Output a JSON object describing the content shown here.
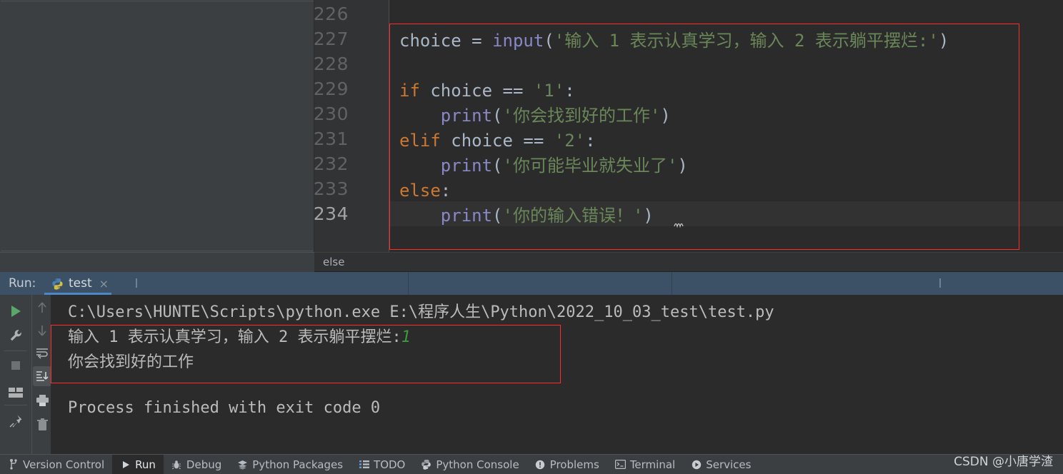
{
  "editor": {
    "breadcrumb": "else",
    "line_numbers": [
      "226",
      "227",
      "228",
      "229",
      "230",
      "231",
      "232",
      "233",
      "234"
    ],
    "current_line": "234",
    "lines": [
      {
        "num": "226",
        "segments": []
      },
      {
        "num": "227",
        "segments": [
          {
            "t": "choice ",
            "c": "id"
          },
          {
            "t": "= ",
            "c": "punc"
          },
          {
            "t": "input",
            "c": "fn"
          },
          {
            "t": "(",
            "c": "punc"
          },
          {
            "t": "'输入 1 表示认真学习，输入 2 表示躺平摆烂:'",
            "c": "str"
          },
          {
            "t": ")",
            "c": "punc"
          }
        ]
      },
      {
        "num": "228",
        "segments": []
      },
      {
        "num": "229",
        "segments": [
          {
            "t": "if",
            "c": "kw"
          },
          {
            "t": " choice ",
            "c": "id"
          },
          {
            "t": "== ",
            "c": "punc"
          },
          {
            "t": "'1'",
            "c": "str"
          },
          {
            "t": ":",
            "c": "punc"
          }
        ]
      },
      {
        "num": "230",
        "segments": [
          {
            "t": "    ",
            "c": "punc"
          },
          {
            "t": "print",
            "c": "fn"
          },
          {
            "t": "(",
            "c": "punc"
          },
          {
            "t": "'你会找到好的工作'",
            "c": "str"
          },
          {
            "t": ")",
            "c": "punc"
          }
        ]
      },
      {
        "num": "231",
        "segments": [
          {
            "t": "elif",
            "c": "kw"
          },
          {
            "t": " choice ",
            "c": "id"
          },
          {
            "t": "== ",
            "c": "punc"
          },
          {
            "t": "'2'",
            "c": "str"
          },
          {
            "t": ":",
            "c": "punc"
          }
        ]
      },
      {
        "num": "232",
        "segments": [
          {
            "t": "    ",
            "c": "punc"
          },
          {
            "t": "print",
            "c": "fn"
          },
          {
            "t": "(",
            "c": "punc"
          },
          {
            "t": "'你可能毕业就失业了'",
            "c": "str"
          },
          {
            "t": ")",
            "c": "punc"
          }
        ]
      },
      {
        "num": "233",
        "segments": [
          {
            "t": "else",
            "c": "kw"
          },
          {
            "t": ":",
            "c": "punc"
          }
        ]
      },
      {
        "num": "234",
        "segments": [
          {
            "t": "    ",
            "c": "punc"
          },
          {
            "t": "print",
            "c": "fn"
          },
          {
            "t": "(",
            "c": "punc"
          },
          {
            "t": "'你的输入错误！'",
            "c": "str"
          },
          {
            "t": ")",
            "c": "punc"
          }
        ]
      }
    ]
  },
  "run_panel": {
    "run_label": "Run:",
    "tab_name": "test",
    "tab_close": "×",
    "tab_icon": "python-icon",
    "toolbar_primary": [
      {
        "name": "rerun-icon",
        "title": "Rerun"
      },
      {
        "name": "wrench-icon",
        "title": "Modify Run Configuration"
      },
      {
        "name": "stop-icon",
        "title": "Stop"
      },
      {
        "name": "layout-icon",
        "title": "Layout"
      },
      {
        "name": "pin-icon",
        "title": "Pin Tab"
      }
    ],
    "toolbar_secondary": [
      {
        "name": "arrow-up-icon",
        "title": "Up the Stack Trace"
      },
      {
        "name": "arrow-down-icon",
        "title": "Down the Stack Trace"
      },
      {
        "name": "soft-wrap-icon",
        "title": "Soft-Wrap"
      },
      {
        "name": "scroll-to-end-icon",
        "title": "Scroll to End"
      },
      {
        "name": "print-icon",
        "title": "Print"
      },
      {
        "name": "trash-icon",
        "title": "Clear All"
      }
    ],
    "console_lines": [
      {
        "text": "C:\\Users\\HUNTE\\Scripts\\python.exe E:\\程序人生\\Python\\2022_10_03_test\\test.py",
        "kind": "cmd"
      },
      {
        "text": "输入 1 表示认真学习，输入 2 表示躺平摆烂:",
        "input": "1",
        "kind": "prompt"
      },
      {
        "text": "你会找到好的工作",
        "kind": "out"
      },
      {
        "text": "",
        "kind": "blank"
      },
      {
        "text": "Process finished with exit code 0",
        "kind": "out"
      }
    ]
  },
  "statusbar": {
    "items": [
      {
        "label": "Version Control",
        "icon": "branch-icon",
        "active": false
      },
      {
        "label": "Run",
        "icon": "play-icon",
        "active": true
      },
      {
        "label": "Debug",
        "icon": "bug-icon",
        "active": false
      },
      {
        "label": "Python Packages",
        "icon": "stack-icon",
        "active": false
      },
      {
        "label": "TODO",
        "icon": "list-icon",
        "active": false
      },
      {
        "label": "Python Console",
        "icon": "python-icon",
        "active": false
      },
      {
        "label": "Problems",
        "icon": "warning-icon",
        "active": false
      },
      {
        "label": "Terminal",
        "icon": "terminal-icon",
        "active": false
      },
      {
        "label": "Services",
        "icon": "services-icon",
        "active": false
      }
    ]
  },
  "watermark": "CSDN @小唐学渣",
  "colors": {
    "background": "#2b2b2b",
    "panel": "#3c3f41",
    "gutter": "#313335",
    "tabbar": "#3c5166",
    "keyword": "#cc7832",
    "function": "#8888c6",
    "string": "#6a8759",
    "identifier": "#a9b7c6",
    "highlight_box": "#ff2a2a",
    "tab_underline": "#4a88c7",
    "user_input": "#3c9a3c"
  }
}
